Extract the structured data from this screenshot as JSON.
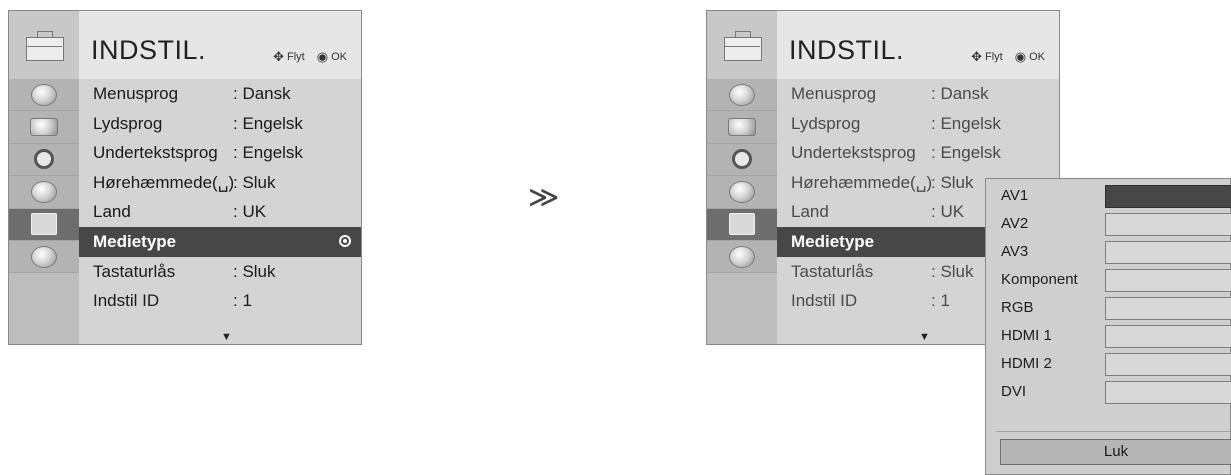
{
  "menu": {
    "title": "INDSTIL.",
    "hints": [
      {
        "icon": "move-arrows-icon",
        "glyph": "✥",
        "label": "Flyt"
      },
      {
        "icon": "ok-button-icon",
        "glyph": "◉",
        "label": "OK"
      }
    ],
    "side_icons": [
      "satellite-dish-icon",
      "monitor-icon",
      "speaker-icon",
      "clock-icon",
      "toolbox-icon",
      "lock-icon"
    ],
    "active_side_index": 4,
    "rows": [
      {
        "label": "Menusprog",
        "value": ": Dansk"
      },
      {
        "label": "Lydsprog",
        "value": ": Engelsk"
      },
      {
        "label": "Undertekstsprog",
        "value": ": Engelsk"
      },
      {
        "label": "Hørehæmmede(␣)",
        "value": ": Sluk"
      },
      {
        "label": "Land",
        "value": ": UK"
      },
      {
        "label": "Medietype",
        "value": ""
      },
      {
        "label": "Tastaturlås",
        "value": ": Sluk"
      },
      {
        "label": "Indstil ID",
        "value": ": 1"
      }
    ],
    "selected_row_index": 5,
    "scroll_indicator": "▼"
  },
  "transition_arrow": "≫",
  "popup": {
    "items": [
      "AV1",
      "AV2",
      "AV3",
      "Komponent",
      "RGB",
      "HDMI 1",
      "HDMI 2",
      "DVI"
    ],
    "active_index": 0,
    "close_label": "Luk"
  }
}
